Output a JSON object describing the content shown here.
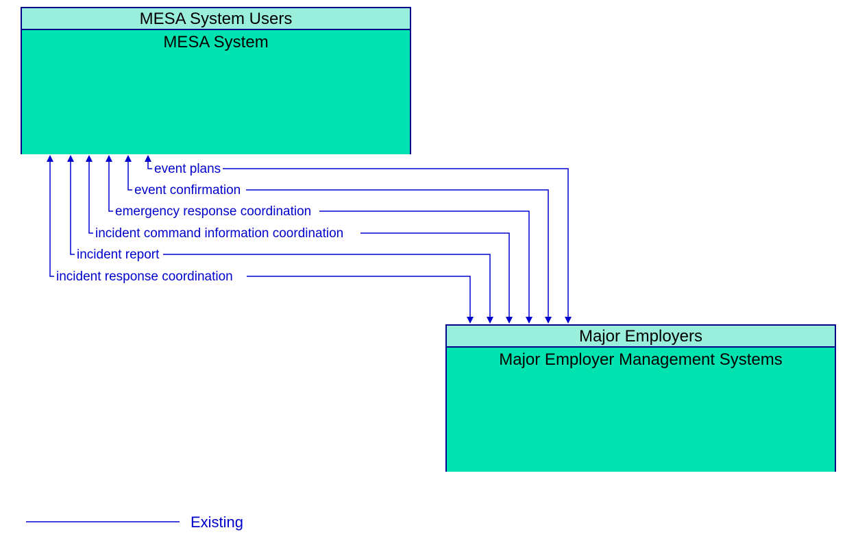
{
  "boxes": {
    "top": {
      "header": "MESA System Users",
      "body": "MESA System"
    },
    "bottom": {
      "header": "Major Employers",
      "body": "Major Employer Management Systems"
    }
  },
  "flows": [
    {
      "label": "event plans"
    },
    {
      "label": "event confirmation"
    },
    {
      "label": "emergency response coordination"
    },
    {
      "label": "incident command information coordination"
    },
    {
      "label": "incident report"
    },
    {
      "label": "incident response coordination"
    }
  ],
  "legend": {
    "existing": "Existing"
  },
  "colors": {
    "line": "#0000cd",
    "boxBody": "#00e2b0",
    "boxHeader": "#99efdb",
    "border": "#00008B"
  }
}
